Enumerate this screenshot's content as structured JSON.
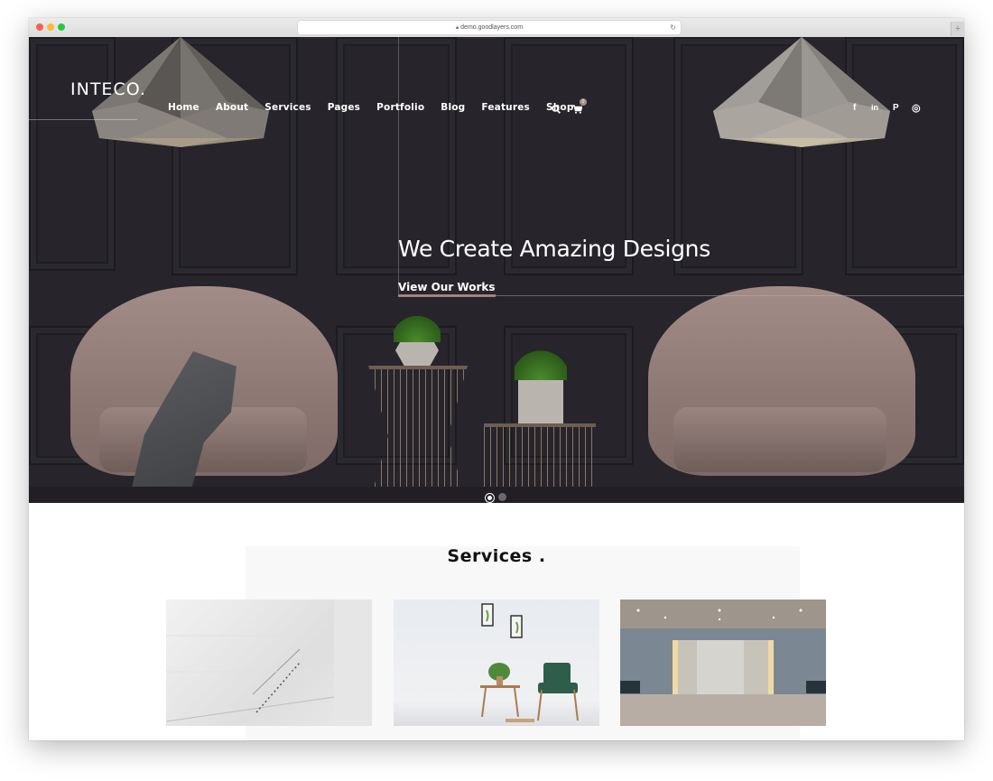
{
  "browser": {
    "url": "demo.goodlayers.com",
    "lock_icon": "lock-icon",
    "reload_icon": "reload-icon",
    "new_tab_label": "+"
  },
  "header": {
    "logo": "INTECO.",
    "nav": [
      {
        "label": "Home"
      },
      {
        "label": "About"
      },
      {
        "label": "Services"
      },
      {
        "label": "Pages"
      },
      {
        "label": "Portfolio"
      },
      {
        "label": "Blog"
      },
      {
        "label": "Features"
      },
      {
        "label": "Shop"
      }
    ],
    "search_icon": "search-icon",
    "cart_icon": "cart-icon",
    "cart_count": "0",
    "social": [
      {
        "name": "facebook-icon",
        "glyph": "f"
      },
      {
        "name": "linkedin-icon",
        "glyph": "in"
      },
      {
        "name": "pinterest-icon",
        "glyph": "P"
      },
      {
        "name": "instagram-icon",
        "glyph": "◎"
      }
    ]
  },
  "hero": {
    "title": "We Create Amazing Designs",
    "link_label": "View Our Works",
    "slides_total": 2,
    "active_slide": 1
  },
  "services": {
    "title": "Services .",
    "cards": [
      {
        "name": "concrete-staircase-image"
      },
      {
        "name": "green-chair-interior-image"
      },
      {
        "name": "lobby-interior-image"
      }
    ]
  },
  "colors": {
    "hero_bg": "#27252b",
    "accent": "#a0908c",
    "text_dark": "#111111"
  }
}
